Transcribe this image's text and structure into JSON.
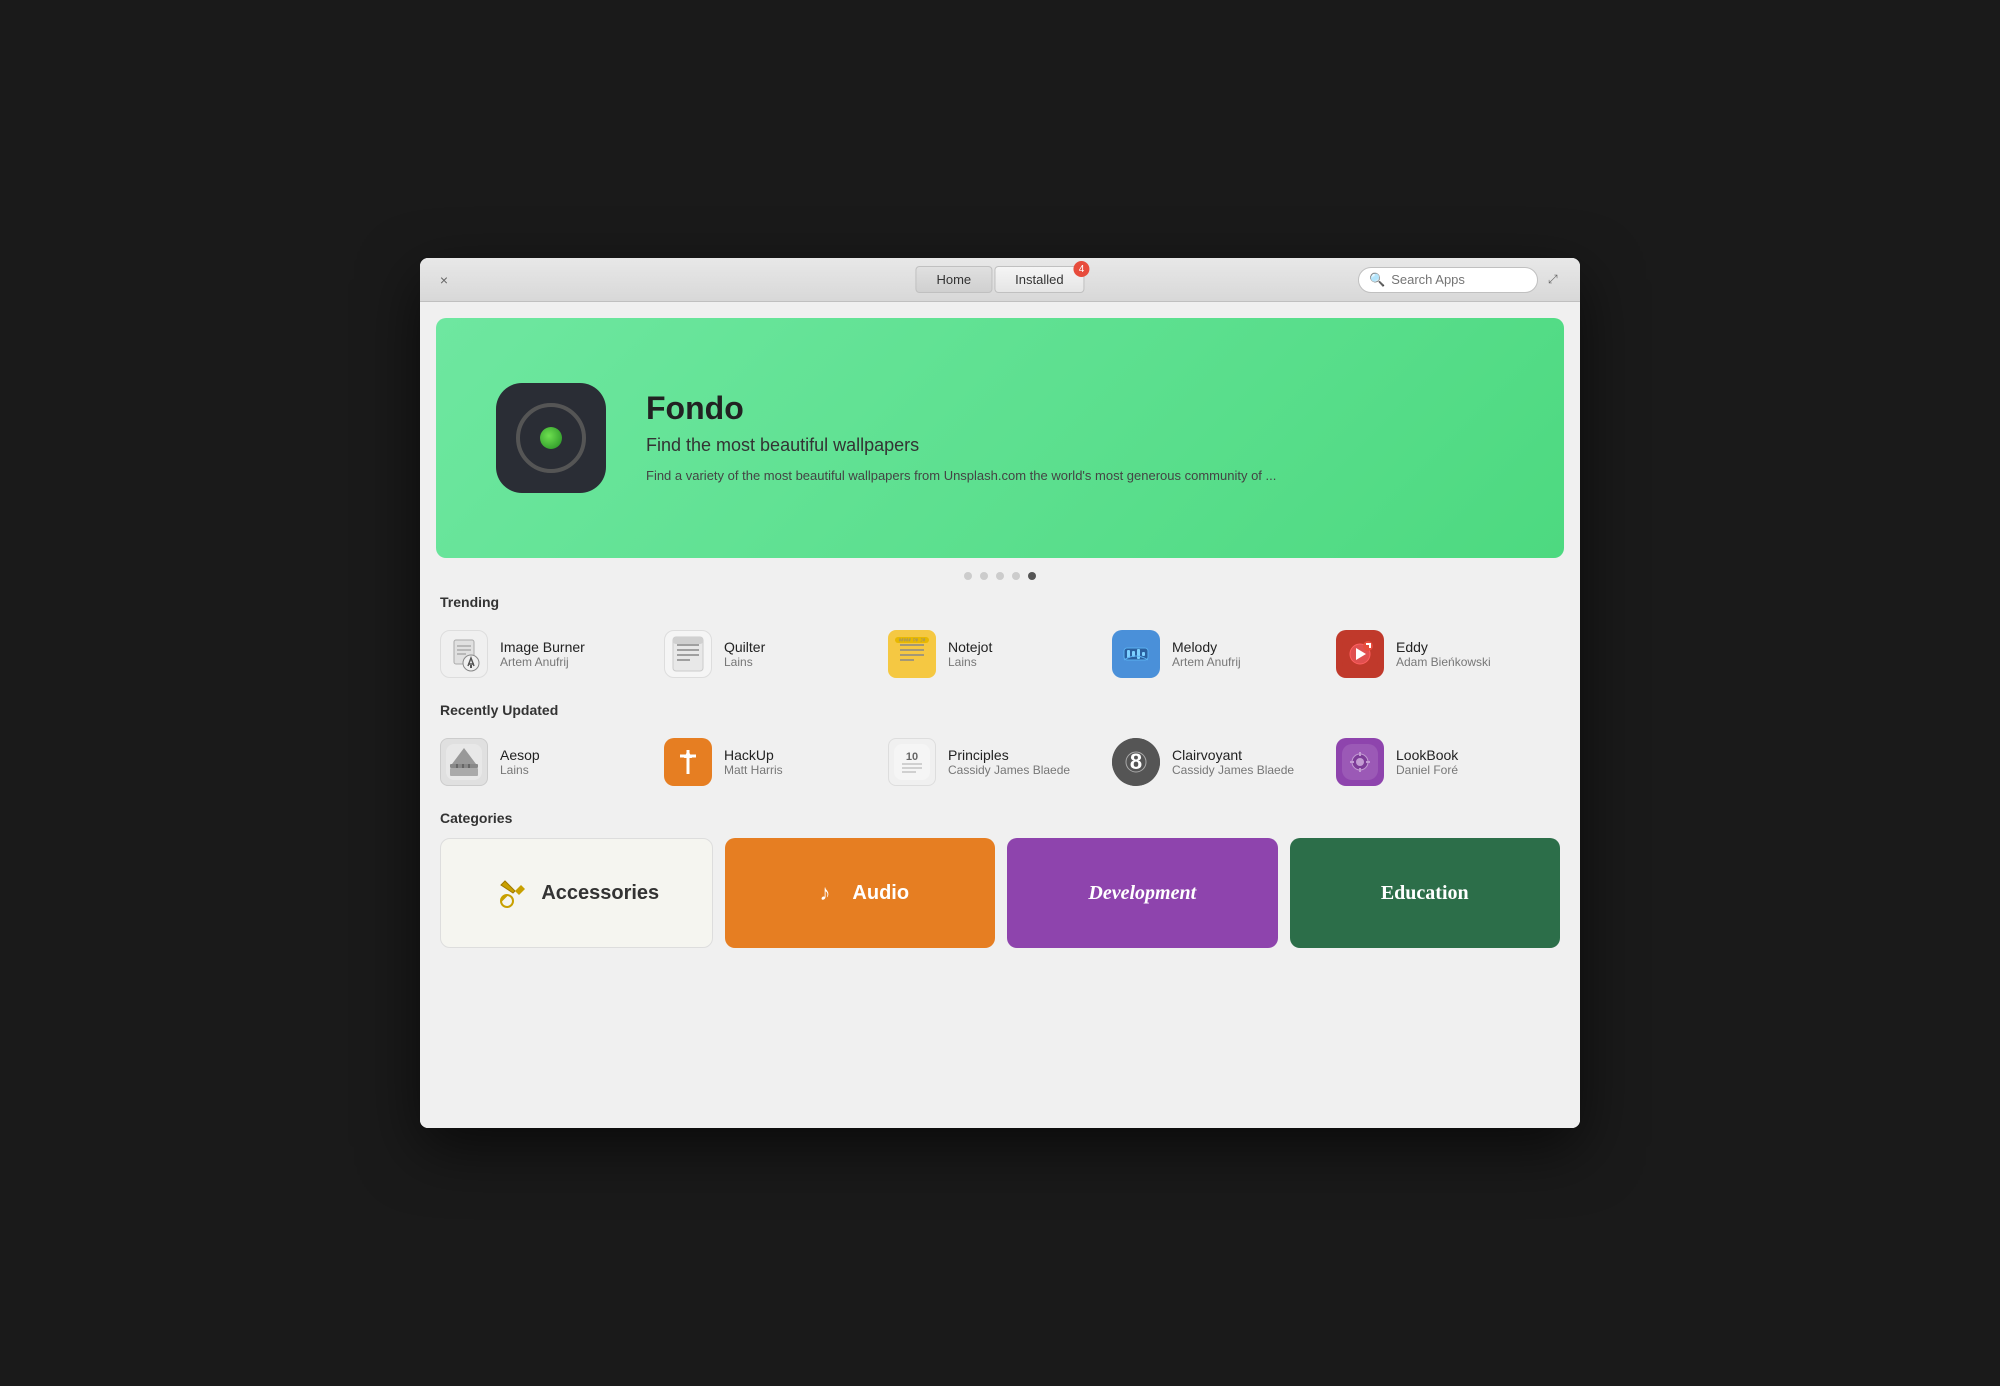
{
  "window": {
    "close_label": "×",
    "fullscreen_label": "⤢"
  },
  "titlebar": {
    "home_tab": "Home",
    "installed_tab": "Installed",
    "installed_badge": "4",
    "search_placeholder": "Search Apps"
  },
  "hero": {
    "app_name": "Fondo",
    "tagline": "Find the most beautiful wallpapers",
    "description": "Find a variety of the most beautiful wallpapers from Unsplash.com the world's most generous community of ..."
  },
  "dots": [
    {
      "active": false
    },
    {
      "active": false
    },
    {
      "active": false
    },
    {
      "active": false
    },
    {
      "active": true
    }
  ],
  "trending": {
    "title": "Trending",
    "apps": [
      {
        "name": "Image Burner",
        "author": "Artem Anufrij",
        "icon_type": "image-burner"
      },
      {
        "name": "Quilter",
        "author": "Lains",
        "icon_type": "quilter"
      },
      {
        "name": "Notejot",
        "author": "Lains",
        "icon_type": "notejot"
      },
      {
        "name": "Melody",
        "author": "Artem Anufrij",
        "icon_type": "melody"
      },
      {
        "name": "Eddy",
        "author": "Adam Bieńkowski",
        "icon_type": "eddy"
      }
    ]
  },
  "recently_updated": {
    "title": "Recently Updated",
    "apps": [
      {
        "name": "Aesop",
        "author": "Lains",
        "icon_type": "aesop"
      },
      {
        "name": "HackUp",
        "author": "Matt Harris",
        "icon_type": "hackup"
      },
      {
        "name": "Principles",
        "author": "Cassidy James Blaede",
        "icon_type": "principles"
      },
      {
        "name": "Clairvoyant",
        "author": "Cassidy James Blaede",
        "icon_type": "clairvoyant"
      },
      {
        "name": "LookBook",
        "author": "Daniel Foré",
        "icon_type": "lookbook"
      }
    ]
  },
  "categories": {
    "title": "Categories",
    "items": [
      {
        "name": "Accessories",
        "type": "accessories",
        "icon": "✂"
      },
      {
        "name": "Audio",
        "type": "audio",
        "icon": "♪"
      },
      {
        "name": "Development",
        "type": "development",
        "icon": ""
      },
      {
        "name": "Education",
        "type": "education",
        "icon": ""
      }
    ]
  }
}
